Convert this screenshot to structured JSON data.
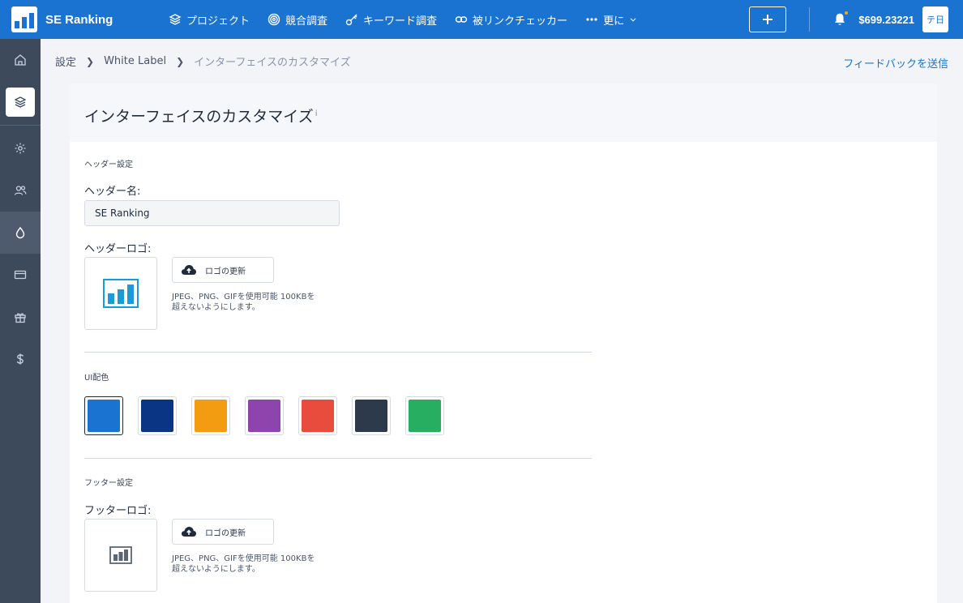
{
  "app": {
    "name": "SE Ranking",
    "brand_color": "#1a73d0"
  },
  "topnav": {
    "items": [
      {
        "label": "プロジェクト",
        "icon": "layers-icon"
      },
      {
        "label": "競合調査",
        "icon": "target-icon"
      },
      {
        "label": "キーワード調査",
        "icon": "key-icon"
      },
      {
        "label": "被リンクチェッカー",
        "icon": "link-icon"
      },
      {
        "label": "更に",
        "icon": "more-dots-icon"
      }
    ],
    "balance": "$699.23221",
    "avatar_text": "テ日"
  },
  "breadcrumb": [
    "設定",
    "White Label",
    "インターフェイスのカスタマイズ"
  ],
  "feedback_link": "フィードバックを送信",
  "page": {
    "title": "インターフェイスのカスタマイズ",
    "info_mark": "i",
    "header_section": {
      "section_label": "ヘッダー設定",
      "name_label": "ヘッダー名:",
      "name_value": "SE Ranking",
      "logo_label": "ヘッダーロゴ:",
      "upload_label": "ロゴの更新",
      "hint_line1": "JPEG、PNG、GIFを使用可能 100KBを",
      "hint_line2": "超えないようにします。"
    },
    "ui_colors": {
      "section_label": "UI配色",
      "options": [
        "#1a73d0",
        "#0a3584",
        "#f39c12",
        "#8e44ad",
        "#e74c3c",
        "#2c3a4b",
        "#27ae60"
      ],
      "selected": "#1a73d0"
    },
    "footer_section": {
      "section_label": "フッター設定",
      "logo_label": "フッターロゴ:",
      "upload_label": "ロゴの更新",
      "hint_line1": "JPEG、PNG、GIFを使用可能 100KBを",
      "hint_line2": "超えないようにします。"
    }
  },
  "sidebar": {
    "items": [
      "home-icon",
      "layers-icon",
      "gear-icon",
      "users-icon",
      "drop-icon",
      "card-icon",
      "gift-icon",
      "dollar-icon"
    ]
  }
}
